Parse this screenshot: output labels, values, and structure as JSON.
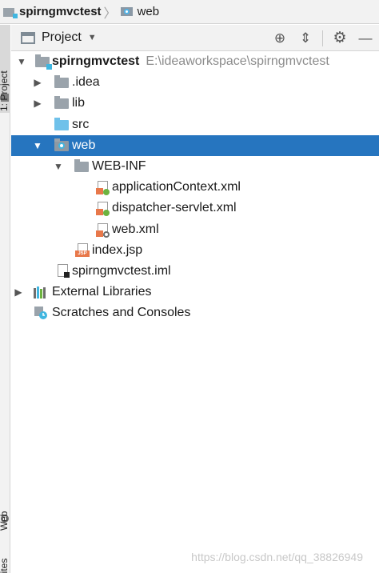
{
  "breadcrumb": {
    "project": "spirngmvctest",
    "folder": "web"
  },
  "left_strip": {
    "project_tab": "1: Project",
    "web_tab": "Web",
    "favorites_tab": "Favorites"
  },
  "project_panel": {
    "view_mode": "Project"
  },
  "tree": {
    "root_name": "spirngmvctest",
    "root_path": "E:\\ideaworkspace\\spirngmvctest",
    "idea": ".idea",
    "lib": "lib",
    "src": "src",
    "web": "web",
    "web_inf": "WEB-INF",
    "app_context": "applicationContext.xml",
    "dispatcher": "dispatcher-servlet.xml",
    "web_xml": "web.xml",
    "index_jsp": "index.jsp",
    "iml": "spirngmvctest.iml",
    "external_libs": "External Libraries",
    "scratches": "Scratches and Consoles"
  },
  "watermark": "https://blog.csdn.net/qq_38826949",
  "colors": {
    "selection": "#2675bf",
    "folder_gray": "#9aa3ab",
    "folder_blue": "#6fc1ea",
    "spring_green": "#6db33f",
    "xml_orange": "#e8784a"
  }
}
